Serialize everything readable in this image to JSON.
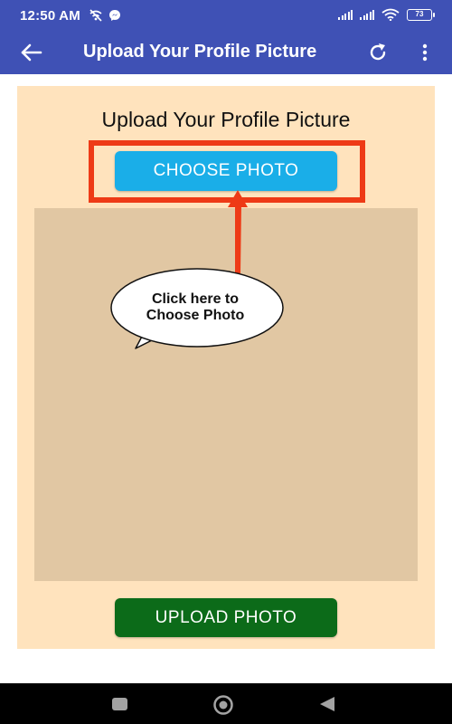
{
  "status_bar": {
    "time": "12:50 AM",
    "battery": "73",
    "icons": [
      "wifi-calling-off-icon",
      "messenger-icon",
      "signal-icon",
      "signal-icon",
      "wifi-icon",
      "battery-icon"
    ]
  },
  "app_bar": {
    "title": "Upload Your Profile Picture",
    "icons": [
      "back-arrow-icon",
      "refresh-icon",
      "more-vert-icon"
    ]
  },
  "main": {
    "heading": "Upload Your Profile Picture",
    "choose_button": "CHOOSE PHOTO",
    "upload_button": "UPLOAD PHOTO",
    "callout_line1": "Click here to",
    "callout_line2": "Choose Photo"
  },
  "colors": {
    "app_bar": "#3f51b5",
    "card_background": "#ffe3bd",
    "preview_area": "#e1c7a3",
    "choose_button": "#1aaee8",
    "upload_button": "#0c6b19",
    "highlight": "#ee3a16"
  }
}
